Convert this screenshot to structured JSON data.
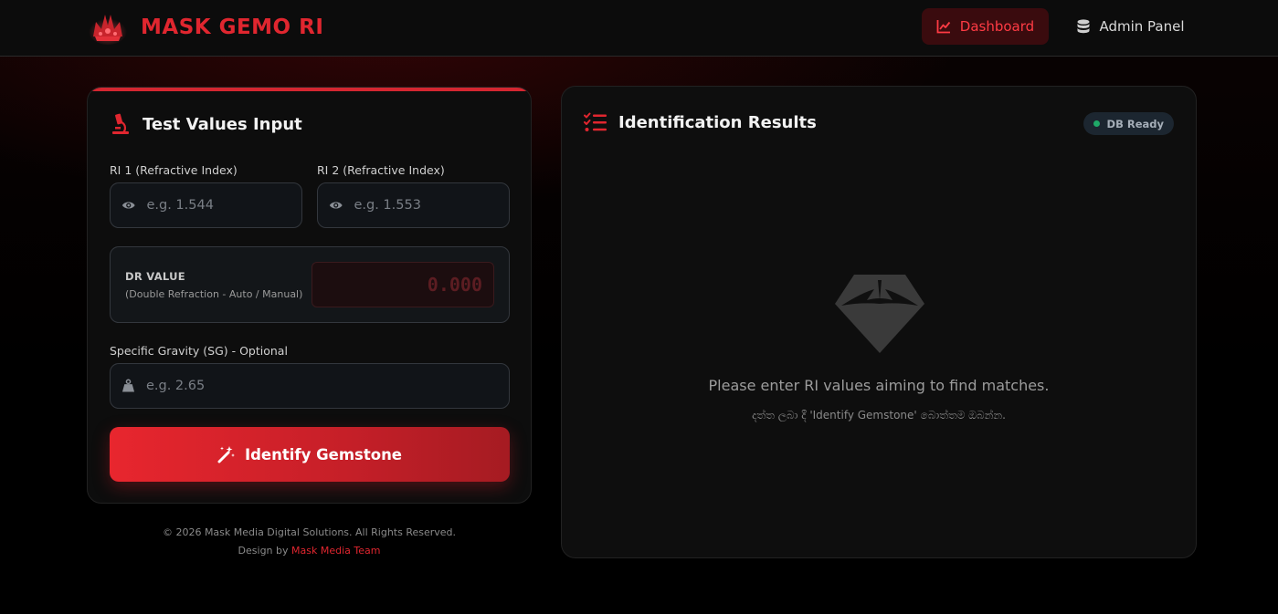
{
  "header": {
    "brand_name": "MASK GEMO RI",
    "nav": {
      "dashboard_label": "Dashboard",
      "admin_label": "Admin Panel"
    }
  },
  "input_card": {
    "title": "Test Values Input",
    "ri1": {
      "label": "RI 1 (Refractive Index)",
      "placeholder": "e.g. 1.544",
      "value": ""
    },
    "ri2": {
      "label": "RI 2 (Refractive Index)",
      "placeholder": "e.g. 1.553",
      "value": ""
    },
    "dr": {
      "title": "DR VALUE",
      "subtitle": "(Double Refraction - Auto / Manual)",
      "value": "0.000"
    },
    "sg": {
      "label": "Specific Gravity (SG) - Optional",
      "placeholder": "e.g. 2.65",
      "value": ""
    },
    "identify_label": "Identify Gemstone"
  },
  "footer": {
    "copyright": "© 2026 Mask Media Digital Solutions. All Rights Reserved.",
    "design_prefix": "Design by",
    "design_team": "Mask Media Team"
  },
  "results_card": {
    "title": "Identification Results",
    "status_badge": "DB Ready",
    "empty_message": "Please enter RI values aiming to find matches.",
    "empty_hint": "දත්ත ලබා දී 'Identify Gemstone' බොත්තම ඔබන්න."
  },
  "icons": {
    "logo": "crown-logo-icon",
    "dashboard": "chart-line-icon",
    "admin": "database-icon",
    "input_title": "microscope-icon",
    "ri_fields": "eye-icon",
    "sg_field": "weight-icon",
    "identify": "magic-wand-icon",
    "results_title": "list-check-icon",
    "empty_state": "gem-icon"
  },
  "colors": {
    "accent": "#e0262f",
    "status_ready": "#1fa968"
  }
}
